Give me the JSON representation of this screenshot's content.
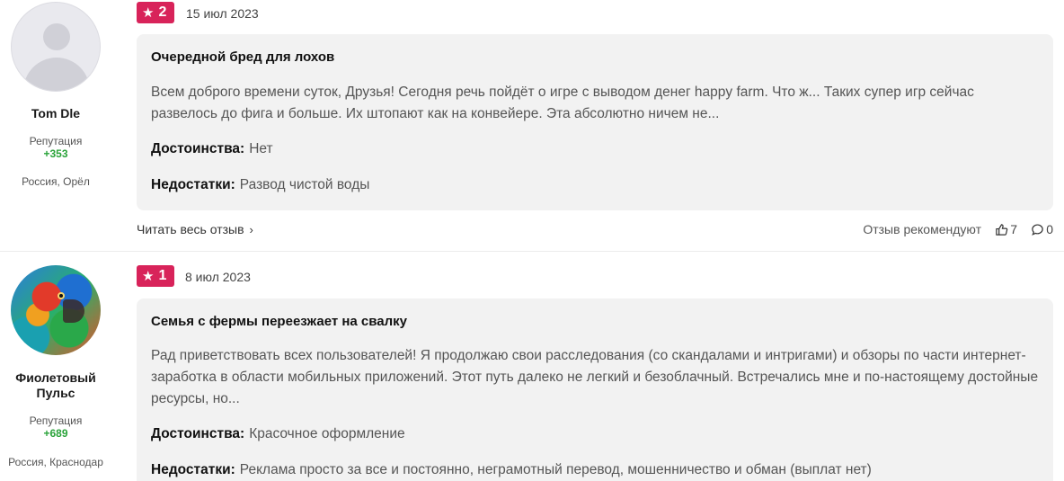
{
  "reviews": [
    {
      "author": {
        "name": "Tom Dle",
        "rep_label": "Репутация",
        "rep_value": "+353",
        "location": "Россия, Орёл"
      },
      "rating": "2",
      "date": "15 июл 2023",
      "title": "Очередной бред для лохов",
      "teaser": "Всем доброго времени суток, Друзья! Сегодня речь пойдёт о игре с выводом денег happy farm. Что ж... Таких супер игр сейчас развелось до фига и больше. Их штопают как на конвейере. Эта абсолютно ничем не...",
      "pros_label": "Достоинства:",
      "pros": "Нет",
      "cons_label": "Недостатки:",
      "cons": "Развод чистой воды",
      "read_more": "Читать весь отзыв",
      "recommend_label": "Отзыв рекомендуют",
      "likes": "7",
      "comments": "0"
    },
    {
      "author": {
        "name": "Фиолетовый Пульс",
        "rep_label": "Репутация",
        "rep_value": "+689",
        "location": "Россия, Краснодар"
      },
      "rating": "1",
      "date": "8 июл 2023",
      "title": "Семья с фермы переезжает на свалку",
      "teaser": "Рад приветствовать всех пользователей! Я продолжаю свои расследования (со скандалами и интригами) и обзоры по части интернет-заработка в области мобильных приложений. Этот путь далеко не легкий и безоблачный. Встречались мне и по-настоящему достойные ресурсы, но...",
      "pros_label": "Достоинства:",
      "pros": "Красочное оформление",
      "cons_label": "Недостатки:",
      "cons": "Реклама просто за все и постоянно, неграмотный перевод, мошенничество и обман (выплат нет)"
    }
  ],
  "icons": {
    "star": "star-icon",
    "chevron": "chevron-right-icon",
    "like": "thumbs-up-icon",
    "comment": "comment-icon"
  },
  "colors": {
    "badge": "#d8235a",
    "reputation": "#2aa33a",
    "card_bg": "#f2f2f2"
  }
}
